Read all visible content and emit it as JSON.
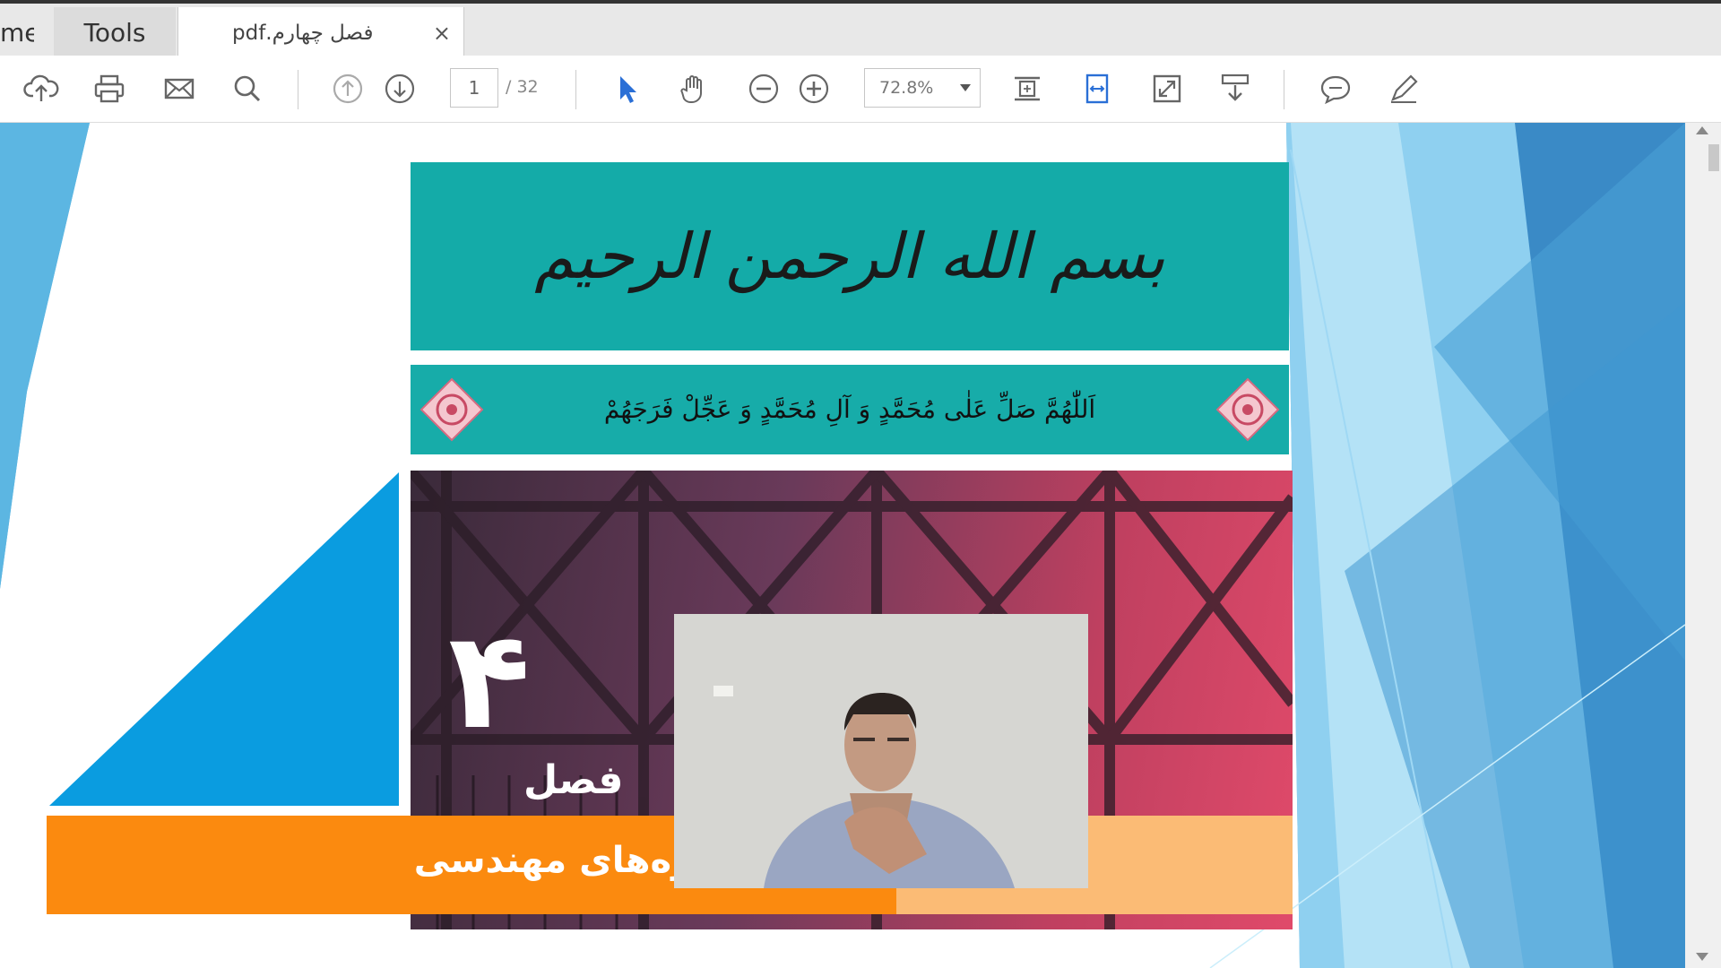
{
  "tabs": {
    "home_label": "me",
    "tools_label": "Tools",
    "doc_title": "فصل چهارم.pdf",
    "close_glyph": "×"
  },
  "toolbar": {
    "page_current": "1",
    "page_total": "/ 32",
    "zoom": "72.8%",
    "icons": [
      "upload-icon",
      "print-icon",
      "email-icon",
      "search-icon",
      "previous-page-icon",
      "next-page-icon",
      "select-arrow-icon",
      "hand-icon",
      "zoom-out-icon",
      "zoom-in-icon",
      "fit-page-icon",
      "fit-width-icon",
      "fullscreen-icon",
      "scroll-mode-icon",
      "comment-icon",
      "sign-icon"
    ]
  },
  "page": {
    "basmala": "بسم الله الرحمن الرحیم",
    "salawat": "اَللّٰهُمَّ صَلِّ عَلٰى مُحَمَّدٍ وَ آلِ مُحَمَّدٍ وَ عَجِّلْ فَرَجَهُمْ",
    "chapter_number": "۴",
    "chapter_word": "فصل",
    "chapter_title": "ل وسازه‌های مهندسی"
  },
  "colors": {
    "accent_teal": "#14aba8",
    "accent_orange": "#fb8a0f",
    "slide_blue": "#5cb6e2",
    "select_blue": "#2a6fd6"
  }
}
